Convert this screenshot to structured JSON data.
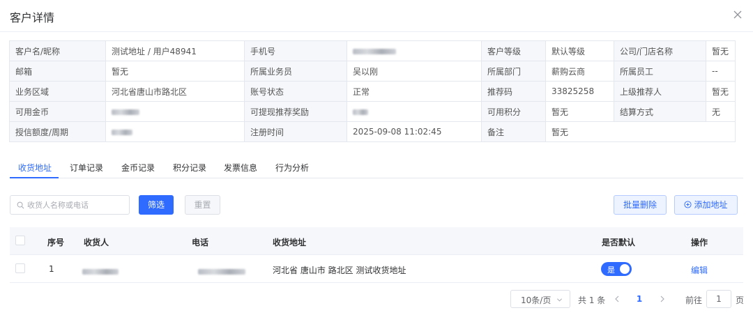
{
  "dialog": {
    "title": "客户详情"
  },
  "info": {
    "rows": [
      [
        {
          "label": "客户名/昵称",
          "value": "测试地址 / 用户48941"
        },
        {
          "label": "手机号",
          "value": "",
          "masked": true
        },
        {
          "label": "客户等级",
          "value": "默认等级"
        },
        {
          "label": "公司/门店名称",
          "value": "暂无"
        }
      ],
      [
        {
          "label": "邮箱",
          "value": "暂无"
        },
        {
          "label": "所属业务员",
          "value": "吴以刚"
        },
        {
          "label": "所属部门",
          "value": "薪购云商"
        },
        {
          "label": "所属员工",
          "value": "--"
        }
      ],
      [
        {
          "label": "业务区域",
          "value": "河北省唐山市路北区"
        },
        {
          "label": "账号状态",
          "value": "正常"
        },
        {
          "label": "推荐码",
          "value": "33825258"
        },
        {
          "label": "上级推荐人",
          "value": "暂无"
        }
      ],
      [
        {
          "label": "可用金币",
          "value": "",
          "masked": true
        },
        {
          "label": "可提现推荐奖励",
          "value": "",
          "masked": true
        },
        {
          "label": "可用积分",
          "value": "暂无"
        },
        {
          "label": "结算方式",
          "value": "无"
        }
      ],
      [
        {
          "label": "授信额度/周期",
          "value": "",
          "masked": true
        },
        {
          "label": "注册时间",
          "value": "2025-09-08 11:02:45"
        },
        {
          "label": "备注",
          "value": "暂无"
        }
      ]
    ]
  },
  "tabs": [
    {
      "label": "收货地址",
      "active": true
    },
    {
      "label": "订单记录"
    },
    {
      "label": "金币记录"
    },
    {
      "label": "积分记录"
    },
    {
      "label": "发票信息"
    },
    {
      "label": "行为分析"
    }
  ],
  "toolbar": {
    "search_placeholder": "收货人名称或电话",
    "filter_label": "筛选",
    "reset_label": "重置",
    "batch_delete_label": "批量删除",
    "add_address_label": "添加地址"
  },
  "table": {
    "columns": [
      "序号",
      "收货人",
      "电话",
      "收货地址",
      "是否默认",
      "操作"
    ],
    "rows": [
      {
        "index": "1",
        "receiver": "",
        "phone": "",
        "address": "河北省 唐山市 路北区 测试收货地址",
        "default_label": "是",
        "is_default": true,
        "action": "编辑"
      }
    ]
  },
  "pagination": {
    "page_size": "10条/页",
    "total": "共 1 条",
    "current_page": "1",
    "goto_label": "前往",
    "goto_value": "1",
    "page_unit": "页"
  },
  "colors": {
    "primary": "#2f6bff",
    "border": "#e4e7ed",
    "label_bg": "#f5f7fa"
  },
  "icons": {
    "close": "close-icon",
    "search": "search-icon",
    "add": "plus-circle-icon",
    "dropdown": "chevron-down-icon",
    "prev": "chevron-left-icon",
    "next": "chevron-right-icon"
  }
}
